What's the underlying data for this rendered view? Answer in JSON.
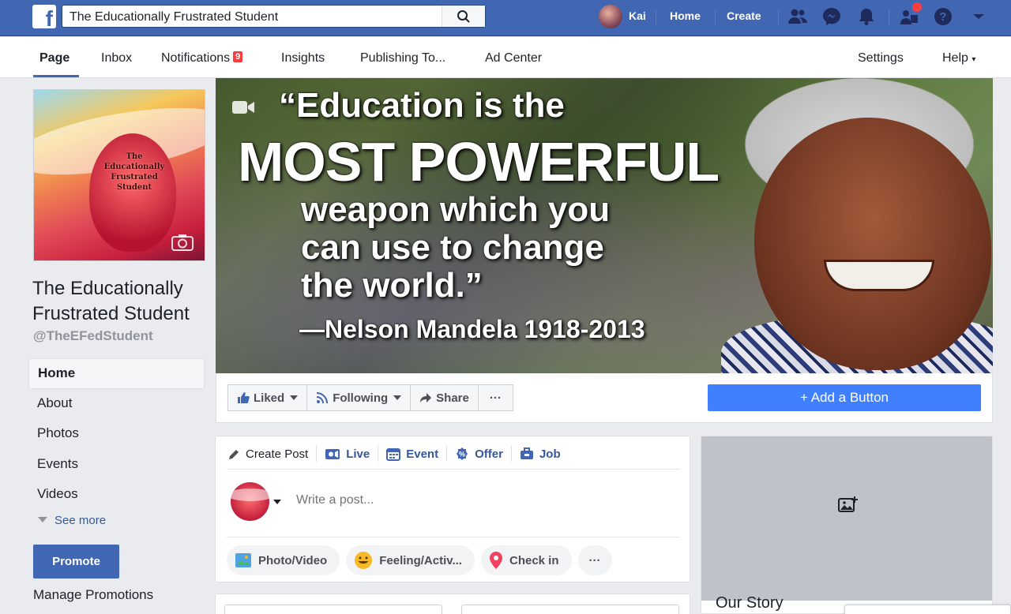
{
  "topbar": {
    "search_value": "The Educationally Frustrated Student",
    "user_name": "Kai",
    "home_label": "Home",
    "create_label": "Create",
    "icons": [
      "friends-icon",
      "messenger-icon",
      "notifications-icon",
      "pages-icon",
      "help-icon",
      "account-menu-icon"
    ]
  },
  "page_nav": {
    "tabs": [
      {
        "label": "Page",
        "active": true
      },
      {
        "label": "Inbox"
      },
      {
        "label": "Notifications",
        "badge": "9"
      },
      {
        "label": "Insights"
      },
      {
        "label": "Publishing To..."
      },
      {
        "label": "Ad Center"
      }
    ],
    "settings_label": "Settings",
    "help_label": "Help"
  },
  "profile": {
    "pic_text": "The Educationally Frustrated Student",
    "name": "The Educationally Frustrated Student",
    "handle": "@TheEFedStudent"
  },
  "left_nav": {
    "items": [
      "Home",
      "About",
      "Photos",
      "Events",
      "Videos"
    ],
    "see_more": "See more",
    "promote": "Promote",
    "manage_promotions": "Manage Promotions"
  },
  "cover": {
    "line1": "“Education is the",
    "line2": "MOST POWERFUL",
    "line3": "weapon which you",
    "line4": "can use to change",
    "line5": "the world.”",
    "attribution": "—Nelson Mandela 1918-2013"
  },
  "actions": {
    "liked": "Liked",
    "following": "Following",
    "share": "Share",
    "more": "···",
    "add_button": "+ Add a Button"
  },
  "composer": {
    "tabs": [
      "Create Post",
      "Live",
      "Event",
      "Offer",
      "Job"
    ],
    "placeholder": "Write a post...",
    "pills": [
      "Photo/Video",
      "Feeling/Activ...",
      "Check in",
      "···"
    ]
  },
  "right": {
    "our_story": "Our Story"
  },
  "colors": {
    "topbar_blue": "#4267b2",
    "link_blue": "#365899",
    "cta_blue": "#4080ff",
    "notification_red": "#fa3e3e"
  }
}
